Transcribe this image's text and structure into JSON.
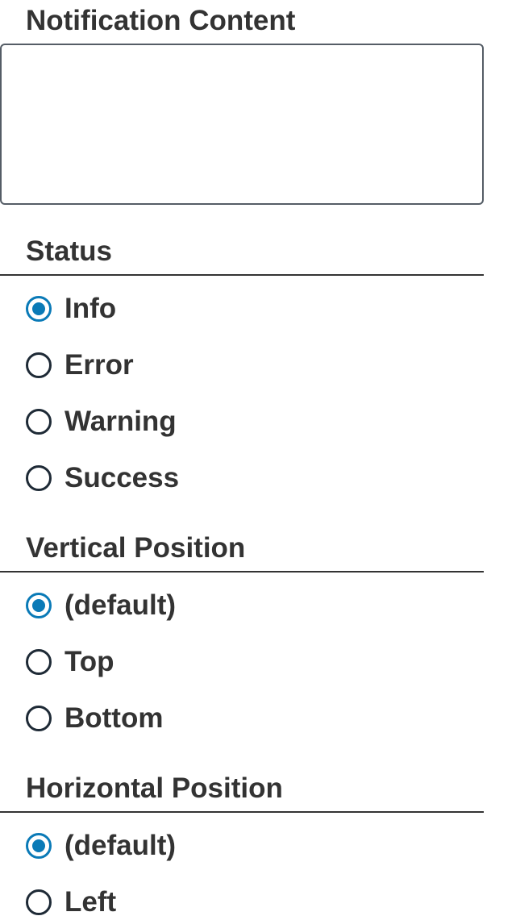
{
  "content": {
    "label": "Notification Content",
    "value": ""
  },
  "status": {
    "legend": "Status",
    "selected": "Info",
    "options": [
      "Info",
      "Error",
      "Warning",
      "Success"
    ]
  },
  "vertical": {
    "legend": "Vertical Position",
    "selected": "(default)",
    "options": [
      "(default)",
      "Top",
      "Bottom"
    ]
  },
  "horizontal": {
    "legend": "Horizontal Position",
    "selected": "(default)",
    "options": [
      "(default)",
      "Left"
    ]
  },
  "colors": {
    "accent": "#0a7ab7",
    "text": "#333333",
    "radio_border": "#1e2a36",
    "field_border": "#555d66"
  }
}
